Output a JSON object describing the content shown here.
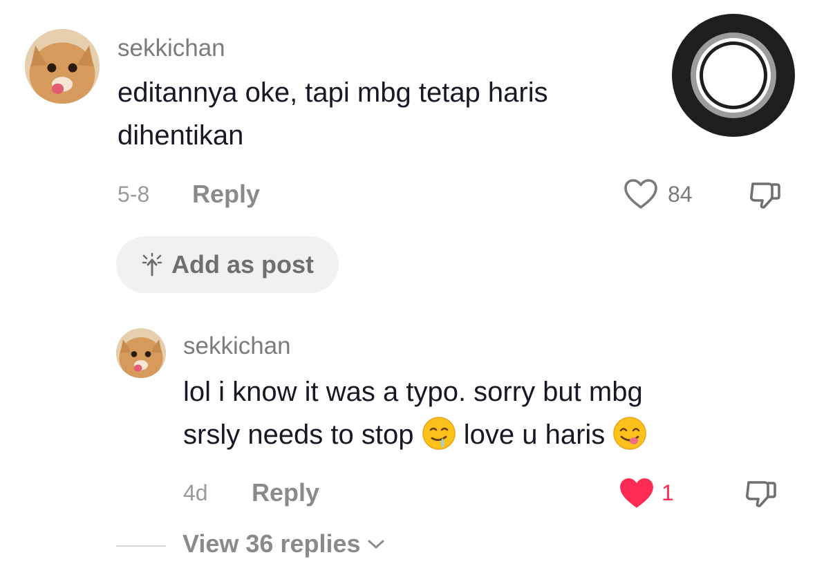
{
  "comment": {
    "username": "sekkichan",
    "text": "editannya oke, tapi mbg tetap haris\ndihentikan",
    "date": "5-8",
    "reply_label": "Reply",
    "like_count": "84",
    "liked": false,
    "add_as_post_label": "Add as post"
  },
  "reply": {
    "username": "sekkichan",
    "text_part1": "lol i know it was a typo. sorry but mbg\nsrsly needs to stop ",
    "emoji1": "drooling-face",
    "text_part2": " love u haris ",
    "emoji2": "face-savoring-food",
    "date": "4d",
    "reply_label": "Reply",
    "like_count": "1",
    "liked": true
  },
  "view_replies_label": "View 36 replies",
  "colors": {
    "like_active": "#fe2c55",
    "text_primary": "#161823",
    "text_secondary": "#8a8a8a"
  }
}
